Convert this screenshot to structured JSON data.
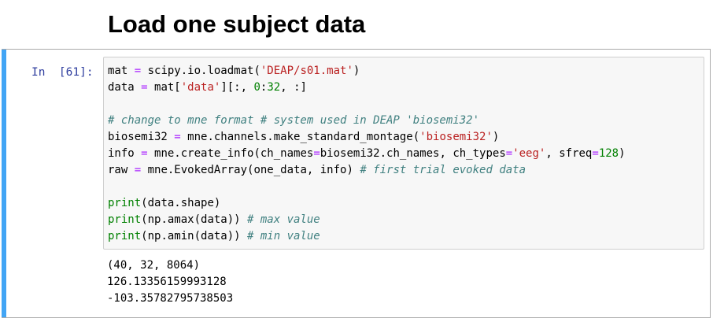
{
  "heading": "Load one subject data",
  "cell": {
    "prompt": "In  [61]:",
    "code": {
      "l1": {
        "a": "mat ",
        "b": "=",
        "c": " scipy.io.loadmat(",
        "d": "'DEAP/s01.mat'",
        "e": ")"
      },
      "l2": {
        "a": "data ",
        "b": "=",
        "c": " mat[",
        "d": "'data'",
        "e": "][:, ",
        "f": "0",
        "g": ":",
        "h": "32",
        "i": ", :]"
      },
      "l4": {
        "a": "# change to mne format # system used in DEAP 'biosemi32'"
      },
      "l5": {
        "a": "biosemi32 ",
        "b": "=",
        "c": " mne.channels.make_standard_montage(",
        "d": "'biosemi32'",
        "e": ")"
      },
      "l6": {
        "a": "info ",
        "b": "=",
        "c": " mne.create_info(ch_names",
        "d": "=",
        "e": "biosemi32.ch_names, ch_types",
        "f": "=",
        "g": "'eeg'",
        "h": ", sfreq",
        "i": "=",
        "j": "128",
        "k": ")"
      },
      "l7": {
        "a": "raw ",
        "b": "=",
        "c": " mne.EvokedArray(one_data, info) ",
        "d": "# first trial evoked data"
      },
      "l9": {
        "a": "print",
        "b": "(data.shape)"
      },
      "l10": {
        "a": "print",
        "b": "(np.amax(data)) ",
        "c": "# max value"
      },
      "l11": {
        "a": "print",
        "b": "(np.amin(data)) ",
        "c": "# min value"
      }
    },
    "output": [
      "(40, 32, 8064)",
      "126.13356159993128",
      "-103.35782795738503"
    ]
  },
  "colors": {
    "cell_bar": "#42a5f5",
    "prompt": "#303f9f",
    "operator": "#aa22ff",
    "string": "#ba2121",
    "number": "#008000",
    "comment": "#408080"
  }
}
